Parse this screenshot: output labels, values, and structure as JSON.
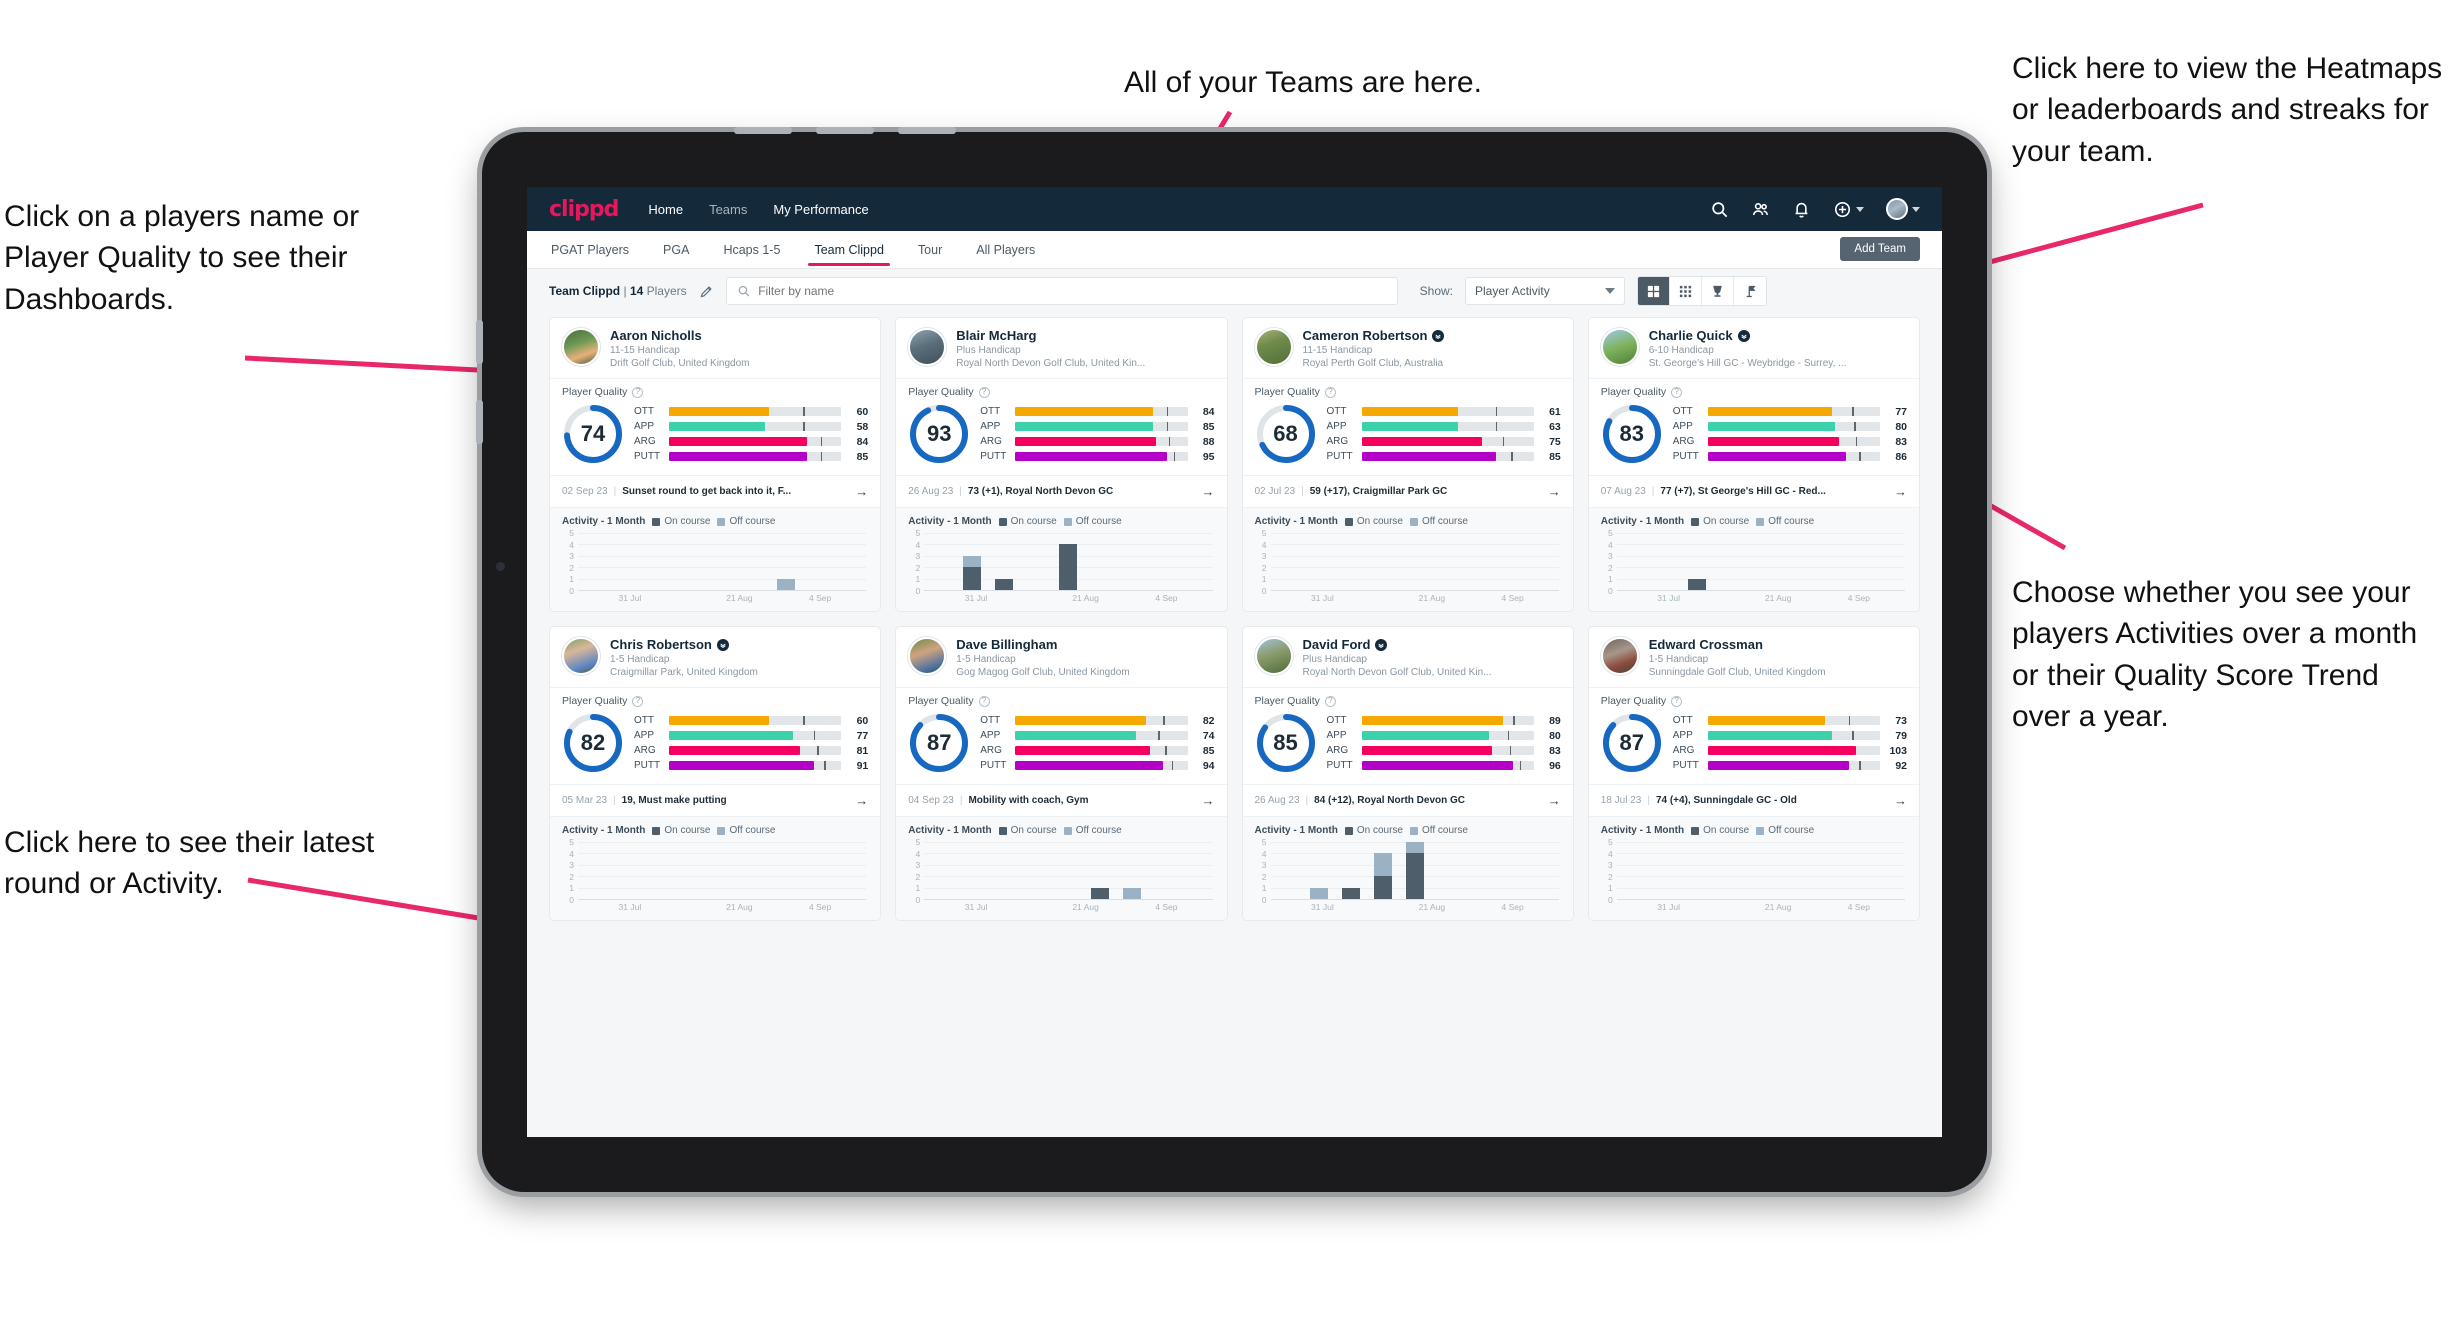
{
  "annotations": {
    "teams": "All of your Teams are here.",
    "heatmaps": "Click here to view the Heatmaps or leaderboards and streaks for your team.",
    "player_names": "Click on a players name or Player Quality to see their Dashboards.",
    "choose_view": "Choose whether you see your players Activities over a month or their Quality Score Trend over a year.",
    "latest_round": "Click here to see their latest round or Activity."
  },
  "topnav": {
    "logo": "clippd",
    "links": [
      {
        "label": "Home",
        "active": true
      },
      {
        "label": "Teams",
        "active": false
      },
      {
        "label": "My Performance",
        "active": true
      }
    ],
    "icons": [
      "search-icon",
      "people-icon",
      "bell-icon",
      "plus-circle-icon"
    ],
    "avatar": "user-avatar"
  },
  "tabs": [
    {
      "label": "PGAT Players",
      "active": false
    },
    {
      "label": "PGA",
      "active": false
    },
    {
      "label": "Hcaps 1-5",
      "active": false
    },
    {
      "label": "Team Clippd",
      "active": true
    },
    {
      "label": "Tour",
      "active": false
    },
    {
      "label": "All Players",
      "active": false
    }
  ],
  "add_team_button": "Add Team",
  "filterbar": {
    "team_name": "Team Clippd",
    "separator": "|",
    "player_count": "14",
    "players_word": "Players",
    "edit_icon": "pencil-icon",
    "search_placeholder": "Filter by name",
    "show_label": "Show:",
    "show_value": "Player Activity",
    "view_toggles": [
      {
        "icon": "grid-large-icon",
        "active": true
      },
      {
        "icon": "grid-small-icon",
        "active": false
      },
      {
        "icon": "trophy-icon",
        "active": false
      },
      {
        "icon": "flag-icon",
        "active": false
      }
    ]
  },
  "card_labels": {
    "player_quality": "Player Quality",
    "activity": "Activity - 1 Month",
    "legend_on": "On course",
    "legend_off": "Off course",
    "arrow": "→"
  },
  "metric_colors": {
    "OTT": "#f5a800",
    "APP": "#3ad1ab",
    "ARG": "#f5005e",
    "PUTT": "#b400c8",
    "ring": "#1668c1",
    "ring_track": "#dfe4e8"
  },
  "chart_axes": {
    "yticks": [
      5,
      4,
      3,
      2,
      1,
      0
    ],
    "xticks": [
      "31 Jul",
      "21 Aug",
      "4 Sep"
    ],
    "ymax": 5,
    "slots": 9
  },
  "players": [
    {
      "name": "Aaron Nicholls",
      "verified": false,
      "handicap": "11-15 Handicap",
      "club": "Drift Golf Club, United Kingdom",
      "avatar_css": "linear-gradient(160deg,#4a6b3c 0%,#6f9a55 40%,#e8b07a 70%,#3f5c33 100%)",
      "quality": 74,
      "metrics": [
        {
          "label": "OTT",
          "value": 60,
          "fill": 58,
          "tick": 78
        },
        {
          "label": "APP",
          "value": 58,
          "fill": 56,
          "tick": 78
        },
        {
          "label": "ARG",
          "value": 84,
          "fill": 80,
          "tick": 88
        },
        {
          "label": "PUTT",
          "value": 85,
          "fill": 80,
          "tick": 88
        }
      ],
      "round_date": "02 Sep 23",
      "round_text": "Sunset round to get back into it, F...",
      "activity": [
        {
          "on": 0,
          "off": 0
        },
        {
          "on": 0,
          "off": 0
        },
        {
          "on": 0,
          "off": 0
        },
        {
          "on": 0,
          "off": 0
        },
        {
          "on": 0,
          "off": 0
        },
        {
          "on": 0,
          "off": 0
        },
        {
          "on": 0,
          "off": 1
        },
        {
          "on": 0,
          "off": 0
        },
        {
          "on": 0,
          "off": 0
        }
      ]
    },
    {
      "name": "Blair McHarg",
      "verified": false,
      "handicap": "Plus Handicap",
      "club": "Royal North Devon Golf Club, United Kin...",
      "avatar_css": "linear-gradient(160deg,#8fa3ae 0%,#5b6f7c 45%,#3f4f5a 100%)",
      "quality": 93,
      "metrics": [
        {
          "label": "OTT",
          "value": 84,
          "fill": 80,
          "tick": 88
        },
        {
          "label": "APP",
          "value": 85,
          "fill": 80,
          "tick": 88
        },
        {
          "label": "ARG",
          "value": 88,
          "fill": 82,
          "tick": 89
        },
        {
          "label": "PUTT",
          "value": 95,
          "fill": 88,
          "tick": 92
        }
      ],
      "round_date": "26 Aug 23",
      "round_text": "73 (+1), Royal North Devon GC",
      "activity": [
        {
          "on": 0,
          "off": 0
        },
        {
          "on": 2,
          "off": 1
        },
        {
          "on": 1,
          "off": 0
        },
        {
          "on": 0,
          "off": 0
        },
        {
          "on": 4,
          "off": 0
        },
        {
          "on": 0,
          "off": 0
        },
        {
          "on": 0,
          "off": 0
        },
        {
          "on": 0,
          "off": 0
        },
        {
          "on": 0,
          "off": 0
        }
      ]
    },
    {
      "name": "Cameron Robertson",
      "verified": true,
      "handicap": "11-15 Handicap",
      "club": "Royal Perth Golf Club, Australia",
      "avatar_css": "linear-gradient(160deg,#a8b27a 0%,#6f8a4a 40%,#52703a 100%)",
      "quality": 68,
      "metrics": [
        {
          "label": "OTT",
          "value": 61,
          "fill": 56,
          "tick": 78
        },
        {
          "label": "APP",
          "value": 63,
          "fill": 56,
          "tick": 78
        },
        {
          "label": "ARG",
          "value": 75,
          "fill": 70,
          "tick": 82
        },
        {
          "label": "PUTT",
          "value": 85,
          "fill": 78,
          "tick": 87
        }
      ],
      "round_date": "02 Jul 23",
      "round_text": "59 (+17), Craigmillar Park GC",
      "activity": [
        {
          "on": 0,
          "off": 0
        },
        {
          "on": 0,
          "off": 0
        },
        {
          "on": 0,
          "off": 0
        },
        {
          "on": 0,
          "off": 0
        },
        {
          "on": 0,
          "off": 0
        },
        {
          "on": 0,
          "off": 0
        },
        {
          "on": 0,
          "off": 0
        },
        {
          "on": 0,
          "off": 0
        },
        {
          "on": 0,
          "off": 0
        }
      ]
    },
    {
      "name": "Charlie Quick",
      "verified": true,
      "handicap": "6-10 Handicap",
      "club": "St. George's Hill GC - Weybridge - Surrey, ...",
      "avatar_css": "linear-gradient(160deg,#9ec9e8 0%,#7fb25c 50%,#4c7f3a 100%)",
      "quality": 83,
      "metrics": [
        {
          "label": "OTT",
          "value": 77,
          "fill": 72,
          "tick": 84
        },
        {
          "label": "APP",
          "value": 80,
          "fill": 74,
          "tick": 85
        },
        {
          "label": "ARG",
          "value": 83,
          "fill": 76,
          "tick": 86
        },
        {
          "label": "PUTT",
          "value": 86,
          "fill": 80,
          "tick": 88
        }
      ],
      "round_date": "07 Aug 23",
      "round_text": "77 (+7), St George's Hill GC - Red...",
      "activity": [
        {
          "on": 0,
          "off": 0
        },
        {
          "on": 0,
          "off": 0
        },
        {
          "on": 1,
          "off": 0
        },
        {
          "on": 0,
          "off": 0
        },
        {
          "on": 0,
          "off": 0
        },
        {
          "on": 0,
          "off": 0
        },
        {
          "on": 0,
          "off": 0
        },
        {
          "on": 0,
          "off": 0
        },
        {
          "on": 0,
          "off": 0
        }
      ]
    },
    {
      "name": "Chris Robertson",
      "verified": true,
      "handicap": "1-5 Handicap",
      "club": "Craigmillar Park, United Kingdom",
      "avatar_css": "linear-gradient(160deg,#7fa06a 0%,#d9b79a 35%,#5d86c4 75%,#3f5f33 100%)",
      "quality": 82,
      "metrics": [
        {
          "label": "OTT",
          "value": 60,
          "fill": 58,
          "tick": 78
        },
        {
          "label": "APP",
          "value": 77,
          "fill": 72,
          "tick": 84
        },
        {
          "label": "ARG",
          "value": 81,
          "fill": 76,
          "tick": 86
        },
        {
          "label": "PUTT",
          "value": 91,
          "fill": 84,
          "tick": 90
        }
      ],
      "round_date": "05 Mar 23",
      "round_text": "19, Must make putting",
      "activity": [
        {
          "on": 0,
          "off": 0
        },
        {
          "on": 0,
          "off": 0
        },
        {
          "on": 0,
          "off": 0
        },
        {
          "on": 0,
          "off": 0
        },
        {
          "on": 0,
          "off": 0
        },
        {
          "on": 0,
          "off": 0
        },
        {
          "on": 0,
          "off": 0
        },
        {
          "on": 0,
          "off": 0
        },
        {
          "on": 0,
          "off": 0
        }
      ]
    },
    {
      "name": "Dave Billingham",
      "verified": false,
      "handicap": "1-5 Handicap",
      "club": "Gog Magog Golf Club, United Kingdom",
      "avatar_css": "linear-gradient(160deg,#6f8a4a 0%,#cfa380 40%,#4a6fa0 80%,#35502c 100%)",
      "quality": 87,
      "metrics": [
        {
          "label": "OTT",
          "value": 82,
          "fill": 76,
          "tick": 86
        },
        {
          "label": "APP",
          "value": 74,
          "fill": 70,
          "tick": 83
        },
        {
          "label": "ARG",
          "value": 85,
          "fill": 78,
          "tick": 87
        },
        {
          "label": "PUTT",
          "value": 94,
          "fill": 86,
          "tick": 91
        }
      ],
      "round_date": "04 Sep 23",
      "round_text": "Mobility with coach, Gym",
      "activity": [
        {
          "on": 0,
          "off": 0
        },
        {
          "on": 0,
          "off": 0
        },
        {
          "on": 0,
          "off": 0
        },
        {
          "on": 0,
          "off": 0
        },
        {
          "on": 0,
          "off": 0
        },
        {
          "on": 1,
          "off": 0
        },
        {
          "on": 0,
          "off": 1
        },
        {
          "on": 0,
          "off": 0
        },
        {
          "on": 0,
          "off": 0
        }
      ]
    },
    {
      "name": "David Ford",
      "verified": true,
      "handicap": "Plus Handicap",
      "club": "Royal North Devon Golf Club, United Kin...",
      "avatar_css": "linear-gradient(160deg,#9fc3d8 0%,#8a9b6b 45%,#4f6a3c 100%)",
      "quality": 85,
      "metrics": [
        {
          "label": "OTT",
          "value": 89,
          "fill": 82,
          "tick": 88
        },
        {
          "label": "APP",
          "value": 80,
          "fill": 74,
          "tick": 85
        },
        {
          "label": "ARG",
          "value": 83,
          "fill": 76,
          "tick": 86
        },
        {
          "label": "PUTT",
          "value": 96,
          "fill": 88,
          "tick": 92
        }
      ],
      "round_date": "26 Aug 23",
      "round_text": "84 (+12), Royal North Devon GC",
      "activity": [
        {
          "on": 0,
          "off": 0
        },
        {
          "on": 0,
          "off": 1
        },
        {
          "on": 1,
          "off": 0
        },
        {
          "on": 2,
          "off": 2
        },
        {
          "on": 4,
          "off": 1
        },
        {
          "on": 0,
          "off": 0
        },
        {
          "on": 0,
          "off": 0
        },
        {
          "on": 0,
          "off": 0
        },
        {
          "on": 0,
          "off": 0
        }
      ]
    },
    {
      "name": "Edward Crossman",
      "verified": false,
      "handicap": "1-5 Handicap",
      "club": "Sunningdale Golf Club, United Kingdom",
      "avatar_css": "linear-gradient(160deg,#6d6660 0%,#a8968a 40%,#8a4a3c 70%,#4a4440 100%)",
      "quality": 87,
      "metrics": [
        {
          "label": "OTT",
          "value": 73,
          "fill": 68,
          "tick": 82
        },
        {
          "label": "APP",
          "value": 79,
          "fill": 72,
          "tick": 84
        },
        {
          "label": "ARG",
          "value": 103,
          "fill": 86,
          "tick": 0
        },
        {
          "label": "PUTT",
          "value": 92,
          "fill": 82,
          "tick": 88
        }
      ],
      "round_date": "18 Jul 23",
      "round_text": "74 (+4), Sunningdale GC - Old",
      "activity": [
        {
          "on": 0,
          "off": 0
        },
        {
          "on": 0,
          "off": 0
        },
        {
          "on": 0,
          "off": 0
        },
        {
          "on": 0,
          "off": 0
        },
        {
          "on": 0,
          "off": 0
        },
        {
          "on": 0,
          "off": 0
        },
        {
          "on": 0,
          "off": 0
        },
        {
          "on": 0,
          "off": 0
        },
        {
          "on": 0,
          "off": 0
        }
      ]
    }
  ]
}
